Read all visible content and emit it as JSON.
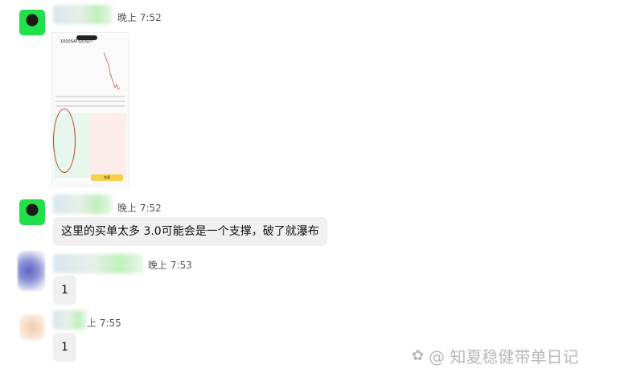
{
  "messages": [
    {
      "id": 1,
      "time": "晚上 7:52",
      "type": "image",
      "avatar_icon": "person-icon"
    },
    {
      "id": 2,
      "time": "晚上 7:52",
      "type": "text",
      "text": "这里的买单太多 3.0可能会是一个支撑，破了就瀑布"
    },
    {
      "id": 3,
      "time": "晚上 7:53",
      "type": "text",
      "text": "1"
    },
    {
      "id": 4,
      "time": "上 7:55",
      "type": "text",
      "text": "1"
    }
  ],
  "screenshot_thumb": {
    "title": "1000SATS/USDT",
    "button": "交易"
  },
  "watermark": {
    "text": "@ 知夏稳健带单日记"
  }
}
